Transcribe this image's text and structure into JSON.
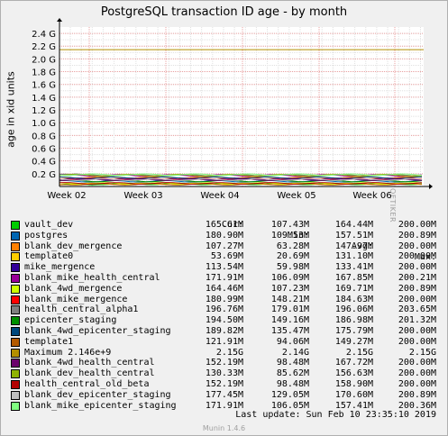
{
  "page": {
    "title": "PostgreSQL transaction ID age - by month",
    "watermark": "RRDTOOL / TOBI OETIKER",
    "last_update": "Last update:  Sun Feb 10 23:35:10 2019",
    "footer": "Munin 1.4.6"
  },
  "legend_header": {
    "cur": "Cur:",
    "min": "Min:",
    "avg": "Avg:",
    "max": "Max:"
  },
  "legend": [
    {
      "name": "vault_dev",
      "color": "#00cc00",
      "cur": "165.61M",
      "min": "107.43M",
      "avg": "164.44M",
      "max": "200.00M"
    },
    {
      "name": "postgres",
      "color": "#0066b3",
      "cur": "180.90M",
      "min": "109.53M",
      "avg": "157.51M",
      "max": "200.89M"
    },
    {
      "name": "blank_dev_mergence",
      "color": "#ff8000",
      "cur": "107.27M",
      "min": "63.28M",
      "avg": "147.97M",
      "max": "200.00M"
    },
    {
      "name": "template0",
      "color": "#ffcc00",
      "cur": "53.69M",
      "min": "20.69M",
      "avg": "131.10M",
      "max": "200.00M"
    },
    {
      "name": "mike_mergence",
      "color": "#330099",
      "cur": "113.54M",
      "min": "59.98M",
      "avg": "133.41M",
      "max": "200.00M"
    },
    {
      "name": "blank_mike_health_central",
      "color": "#990099",
      "cur": "171.91M",
      "min": "106.09M",
      "avg": "167.85M",
      "max": "200.21M"
    },
    {
      "name": "blank_4wd_mergence",
      "color": "#ccff00",
      "cur": "164.46M",
      "min": "107.23M",
      "avg": "169.71M",
      "max": "200.89M"
    },
    {
      "name": "blank_mike_mergence",
      "color": "#ff0000",
      "cur": "180.99M",
      "min": "148.21M",
      "avg": "184.63M",
      "max": "200.00M"
    },
    {
      "name": "health_central_alpha1",
      "color": "#808080",
      "cur": "196.76M",
      "min": "179.01M",
      "avg": "196.06M",
      "max": "203.65M"
    },
    {
      "name": "epicenter_staging",
      "color": "#008f00",
      "cur": "194.50M",
      "min": "149.16M",
      "avg": "186.98M",
      "max": "201.32M"
    },
    {
      "name": "blank_4wd_epicenter_staging",
      "color": "#00487d",
      "cur": "189.82M",
      "min": "135.47M",
      "avg": "175.79M",
      "max": "200.00M"
    },
    {
      "name": "template1",
      "color": "#b35a00",
      "cur": "121.91M",
      "min": "94.06M",
      "avg": "149.27M",
      "max": "200.00M"
    },
    {
      "name": "Maximum 2.146e+9",
      "color": "#b38f00",
      "cur": "2.15G",
      "min": "2.14G",
      "avg": "2.15G",
      "max": "2.15G"
    },
    {
      "name": "blank_4wd_health_central",
      "color": "#6b006b",
      "cur": "152.19M",
      "min": "98.48M",
      "avg": "167.72M",
      "max": "200.00M"
    },
    {
      "name": "blank_dev_health_central",
      "color": "#8fb300",
      "cur": "130.33M",
      "min": "85.62M",
      "avg": "156.63M",
      "max": "200.00M"
    },
    {
      "name": "health_central_old_beta",
      "color": "#b30000",
      "cur": "152.19M",
      "min": "98.48M",
      "avg": "158.90M",
      "max": "200.00M"
    },
    {
      "name": "blank_dev_epicenter_staging",
      "color": "#bebebe",
      "cur": "177.45M",
      "min": "129.05M",
      "avg": "170.60M",
      "max": "200.89M"
    },
    {
      "name": "blank_mike_epicenter_staging",
      "color": "#80ff80",
      "cur": "171.91M",
      "min": "106.05M",
      "avg": "157.41M",
      "max": "200.36M"
    }
  ],
  "chart_data": {
    "type": "line",
    "title": "PostgreSQL transaction ID age - by month",
    "ylabel": "age in xid units",
    "xlabel": "",
    "x_ticks": [
      "Week 02",
      "Week 03",
      "Week 04",
      "Week 05",
      "Week 06"
    ],
    "y_ticks": [
      "0.2 G",
      "0.4 G",
      "0.6 G",
      "0.8 G",
      "1.0 G",
      "1.2 G",
      "1.4 G",
      "1.6 G",
      "1.8 G",
      "2.0 G",
      "2.2 G",
      "2.4 G"
    ],
    "ylim_g": [
      0,
      2.5
    ],
    "grid": true,
    "constant_series": {
      "name": "Maximum 2.146e+9",
      "value_g": 2.146
    },
    "series_value_range_g": [
      0.02,
      0.2
    ],
    "colors": {
      "background": "#ffffff",
      "grid_minor": "#e0e0e0",
      "grid_major": "#e8a0a0"
    }
  }
}
